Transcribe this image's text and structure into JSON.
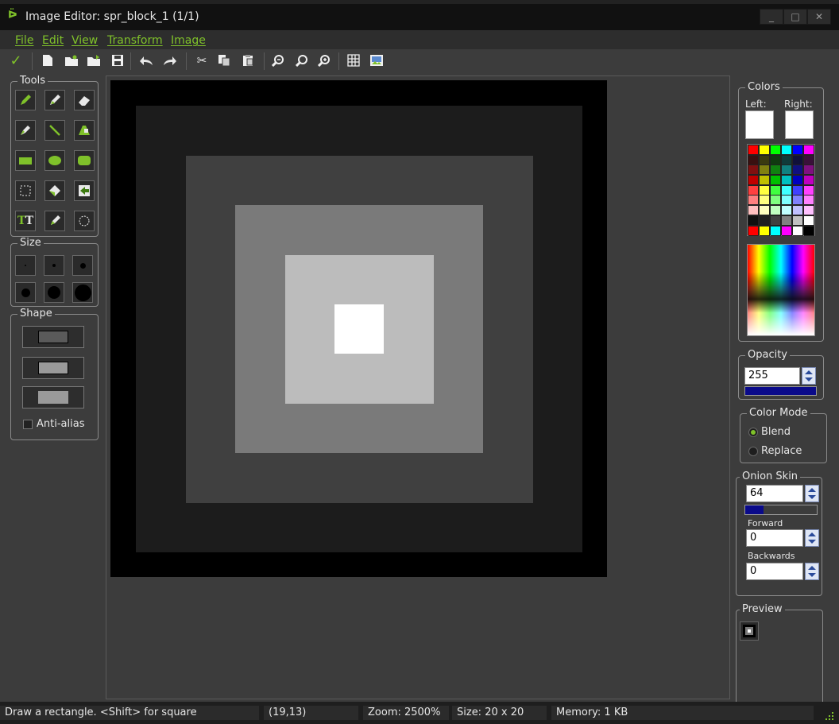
{
  "window": {
    "title": "Image Editor: spr_block_1 (1/1)",
    "minimize": "_",
    "maximize": "□",
    "close": "✕"
  },
  "menu": [
    "File",
    "Edit",
    "View",
    "Transform",
    "Image"
  ],
  "toolbar": {
    "icons": [
      "confirm-check-icon",
      "new-image-icon",
      "open-image-icon",
      "open-folder-icon",
      "save-icon",
      "undo-icon",
      "redo-icon",
      "cut-icon",
      "copy-icon",
      "paste-icon",
      "zoom-out-icon",
      "zoom-reset-icon",
      "zoom-in-icon",
      "grid-icon",
      "image-view-icon"
    ]
  },
  "tools": {
    "label": "Tools",
    "items": [
      "pencil",
      "spray",
      "eraser",
      "color-picker",
      "line",
      "polygon",
      "rectangle",
      "ellipse",
      "rounded-rectangle",
      "select-rect",
      "select-magic",
      "flood-fill",
      "text",
      "change-color",
      "select-ellipse"
    ]
  },
  "size": {
    "label": "Size"
  },
  "shape": {
    "label": "Shape",
    "antialias_label": "Anti-alias"
  },
  "canvas": {
    "colors": [
      "#000000",
      "#1c1c1c",
      "#404040",
      "#7a7a7a",
      "#bcbcbc",
      "#ffffff"
    ]
  },
  "colors": {
    "label": "Colors",
    "left_label": "Left:",
    "right_label": "Right:",
    "left_color": "#ffffff",
    "right_color": "#ffffff",
    "palette": [
      "#ff0000",
      "#ffff00",
      "#00ff00",
      "#00ffff",
      "#0000ff",
      "#ff00ff",
      "#3a1010",
      "#3a3a10",
      "#103a10",
      "#103a3a",
      "#10103a",
      "#3a103a",
      "#801010",
      "#808010",
      "#108010",
      "#108080",
      "#101080",
      "#801080",
      "#c00000",
      "#c0c000",
      "#00c000",
      "#00c0c0",
      "#0000c0",
      "#c000c0",
      "#ff4040",
      "#ffff40",
      "#40ff40",
      "#40ffff",
      "#4040ff",
      "#ff40ff",
      "#ff8080",
      "#ffff80",
      "#80ff80",
      "#80ffff",
      "#8080ff",
      "#ff80ff",
      "#ffc0c0",
      "#ffffc0",
      "#c0ffc0",
      "#c0ffff",
      "#c0c0ff",
      "#ffc0ff",
      "#101010",
      "#202020",
      "#404040",
      "#808080",
      "#c0c0c0",
      "#ffffff",
      "#ff0000",
      "#ffff00",
      "#00ffff",
      "#ff00ff",
      "#ffffff",
      "#000000"
    ]
  },
  "opacity": {
    "label": "Opacity",
    "value": "255",
    "level": 1.0
  },
  "color_mode": {
    "label": "Color Mode",
    "blend": "Blend",
    "replace": "Replace"
  },
  "onion_skin": {
    "label": "Onion Skin",
    "value": "64",
    "level": 0.25,
    "forward_label": "Forward",
    "forward_value": "0",
    "backwards_label": "Backwards",
    "backwards_value": "0"
  },
  "preview": {
    "label": "Preview"
  },
  "status": {
    "hint": "Draw a rectangle. <Shift> for square",
    "coords": "(19,13)",
    "zoom": "Zoom: 2500%",
    "size": "Size: 20 x 20",
    "memory": "Memory: 1 KB"
  }
}
